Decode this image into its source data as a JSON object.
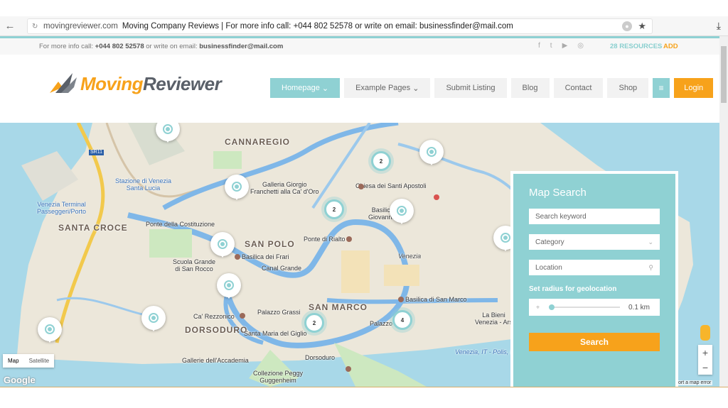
{
  "browser": {
    "domain": "movingreviewer.com",
    "title": "Moving Company Reviews | For more info call: +044 802 52578 or write on email: businessfinder@mail.com"
  },
  "topbar": {
    "info_prefix": "For more info call: ",
    "phone": "+044 802 52578",
    "info_mid": " or write on email: ",
    "email": "businessfinder@mail.com",
    "resources": "28 RESOURCES",
    "add": "ADD"
  },
  "logo": {
    "part1": "Moving",
    "part2": "Reviewer"
  },
  "nav": {
    "items": [
      "Homepage",
      "Example Pages",
      "Submit Listing",
      "Blog",
      "Contact",
      "Shop"
    ],
    "login": "Login"
  },
  "map": {
    "labels": [
      "CANNAREGIO",
      "SANTA CROCE",
      "SAN POLO",
      "SAN MARCO",
      "DORSODURO",
      "Galleria Giorgio\nFranchetti alla Ca' d'Oro",
      "Chiesa dei Santi Apostoli",
      "Ponte della Costituzione",
      "Basilica dei Frari",
      "Canal Grande",
      "Ponte di Rialto",
      "Scuola Grande\ndi San Rocco",
      "Ca' Rezzonico",
      "Palazzo Grassi",
      "Santa Maria del Giglio",
      "Basilica di San Marco",
      "Gallerie dell'Accademia",
      "Collezione Peggy\nGuggenheim",
      "Dorsoduro",
      "Venezia",
      "Stazione di Venezia\nSanta Lucia",
      "Venezia Terminal\nPasseggeri/Porto",
      "SR11",
      "La Bieni\nVenezia - Ars",
      "Basilic\nGiovanni",
      "Palazzo",
      "Venezia, IT - Polis, HR"
    ],
    "clusters": [
      "2",
      "2",
      "2",
      "4"
    ],
    "map_type": [
      "Map",
      "Satellite"
    ],
    "google": "Google",
    "report": "ort a map error"
  },
  "search": {
    "title": "Map Search",
    "keyword_placeholder": "Search keyword",
    "category": "Category",
    "location": "Location",
    "radius_label": "Set radius for geolocation",
    "radius_value": "0.1 km",
    "button": "Search"
  }
}
